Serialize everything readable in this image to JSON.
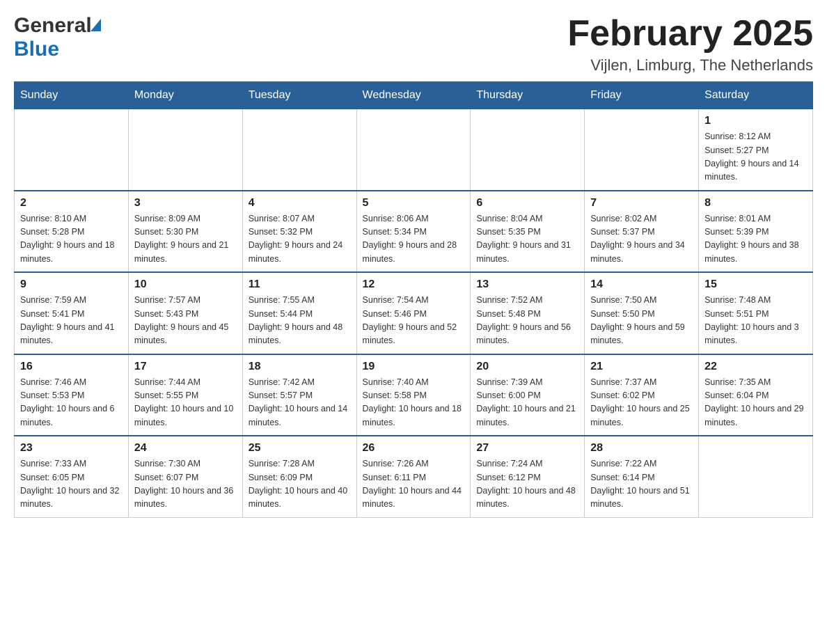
{
  "header": {
    "logo_general": "General",
    "logo_blue": "Blue",
    "title": "February 2025",
    "subtitle": "Vijlen, Limburg, The Netherlands"
  },
  "calendar": {
    "days_of_week": [
      "Sunday",
      "Monday",
      "Tuesday",
      "Wednesday",
      "Thursday",
      "Friday",
      "Saturday"
    ],
    "weeks": [
      [
        {
          "day": "",
          "info": ""
        },
        {
          "day": "",
          "info": ""
        },
        {
          "day": "",
          "info": ""
        },
        {
          "day": "",
          "info": ""
        },
        {
          "day": "",
          "info": ""
        },
        {
          "day": "",
          "info": ""
        },
        {
          "day": "1",
          "info": "Sunrise: 8:12 AM\nSunset: 5:27 PM\nDaylight: 9 hours and 14 minutes."
        }
      ],
      [
        {
          "day": "2",
          "info": "Sunrise: 8:10 AM\nSunset: 5:28 PM\nDaylight: 9 hours and 18 minutes."
        },
        {
          "day": "3",
          "info": "Sunrise: 8:09 AM\nSunset: 5:30 PM\nDaylight: 9 hours and 21 minutes."
        },
        {
          "day": "4",
          "info": "Sunrise: 8:07 AM\nSunset: 5:32 PM\nDaylight: 9 hours and 24 minutes."
        },
        {
          "day": "5",
          "info": "Sunrise: 8:06 AM\nSunset: 5:34 PM\nDaylight: 9 hours and 28 minutes."
        },
        {
          "day": "6",
          "info": "Sunrise: 8:04 AM\nSunset: 5:35 PM\nDaylight: 9 hours and 31 minutes."
        },
        {
          "day": "7",
          "info": "Sunrise: 8:02 AM\nSunset: 5:37 PM\nDaylight: 9 hours and 34 minutes."
        },
        {
          "day": "8",
          "info": "Sunrise: 8:01 AM\nSunset: 5:39 PM\nDaylight: 9 hours and 38 minutes."
        }
      ],
      [
        {
          "day": "9",
          "info": "Sunrise: 7:59 AM\nSunset: 5:41 PM\nDaylight: 9 hours and 41 minutes."
        },
        {
          "day": "10",
          "info": "Sunrise: 7:57 AM\nSunset: 5:43 PM\nDaylight: 9 hours and 45 minutes."
        },
        {
          "day": "11",
          "info": "Sunrise: 7:55 AM\nSunset: 5:44 PM\nDaylight: 9 hours and 48 minutes."
        },
        {
          "day": "12",
          "info": "Sunrise: 7:54 AM\nSunset: 5:46 PM\nDaylight: 9 hours and 52 minutes."
        },
        {
          "day": "13",
          "info": "Sunrise: 7:52 AM\nSunset: 5:48 PM\nDaylight: 9 hours and 56 minutes."
        },
        {
          "day": "14",
          "info": "Sunrise: 7:50 AM\nSunset: 5:50 PM\nDaylight: 9 hours and 59 minutes."
        },
        {
          "day": "15",
          "info": "Sunrise: 7:48 AM\nSunset: 5:51 PM\nDaylight: 10 hours and 3 minutes."
        }
      ],
      [
        {
          "day": "16",
          "info": "Sunrise: 7:46 AM\nSunset: 5:53 PM\nDaylight: 10 hours and 6 minutes."
        },
        {
          "day": "17",
          "info": "Sunrise: 7:44 AM\nSunset: 5:55 PM\nDaylight: 10 hours and 10 minutes."
        },
        {
          "day": "18",
          "info": "Sunrise: 7:42 AM\nSunset: 5:57 PM\nDaylight: 10 hours and 14 minutes."
        },
        {
          "day": "19",
          "info": "Sunrise: 7:40 AM\nSunset: 5:58 PM\nDaylight: 10 hours and 18 minutes."
        },
        {
          "day": "20",
          "info": "Sunrise: 7:39 AM\nSunset: 6:00 PM\nDaylight: 10 hours and 21 minutes."
        },
        {
          "day": "21",
          "info": "Sunrise: 7:37 AM\nSunset: 6:02 PM\nDaylight: 10 hours and 25 minutes."
        },
        {
          "day": "22",
          "info": "Sunrise: 7:35 AM\nSunset: 6:04 PM\nDaylight: 10 hours and 29 minutes."
        }
      ],
      [
        {
          "day": "23",
          "info": "Sunrise: 7:33 AM\nSunset: 6:05 PM\nDaylight: 10 hours and 32 minutes."
        },
        {
          "day": "24",
          "info": "Sunrise: 7:30 AM\nSunset: 6:07 PM\nDaylight: 10 hours and 36 minutes."
        },
        {
          "day": "25",
          "info": "Sunrise: 7:28 AM\nSunset: 6:09 PM\nDaylight: 10 hours and 40 minutes."
        },
        {
          "day": "26",
          "info": "Sunrise: 7:26 AM\nSunset: 6:11 PM\nDaylight: 10 hours and 44 minutes."
        },
        {
          "day": "27",
          "info": "Sunrise: 7:24 AM\nSunset: 6:12 PM\nDaylight: 10 hours and 48 minutes."
        },
        {
          "day": "28",
          "info": "Sunrise: 7:22 AM\nSunset: 6:14 PM\nDaylight: 10 hours and 51 minutes."
        },
        {
          "day": "",
          "info": ""
        }
      ]
    ]
  }
}
